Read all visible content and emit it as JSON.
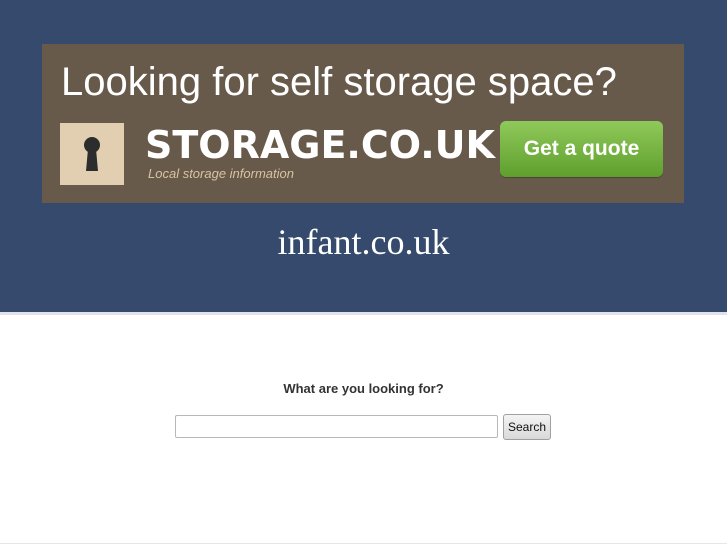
{
  "ad": {
    "headline": "Looking for self storage space?",
    "brand": "STORAGE.CO.UK",
    "tagline": "Local storage information",
    "cta_label": "Get a quote",
    "icon": "keyhole-icon"
  },
  "site": {
    "title": "infant.co.uk"
  },
  "search": {
    "question": "What are you looking for?",
    "input_value": "",
    "input_placeholder": "",
    "button_label": "Search"
  },
  "colors": {
    "header_bg": "#354a6c",
    "ad_bg": "#685a4a",
    "cta_green": "#78b545",
    "keyhole_box": "#e2cfb2"
  }
}
